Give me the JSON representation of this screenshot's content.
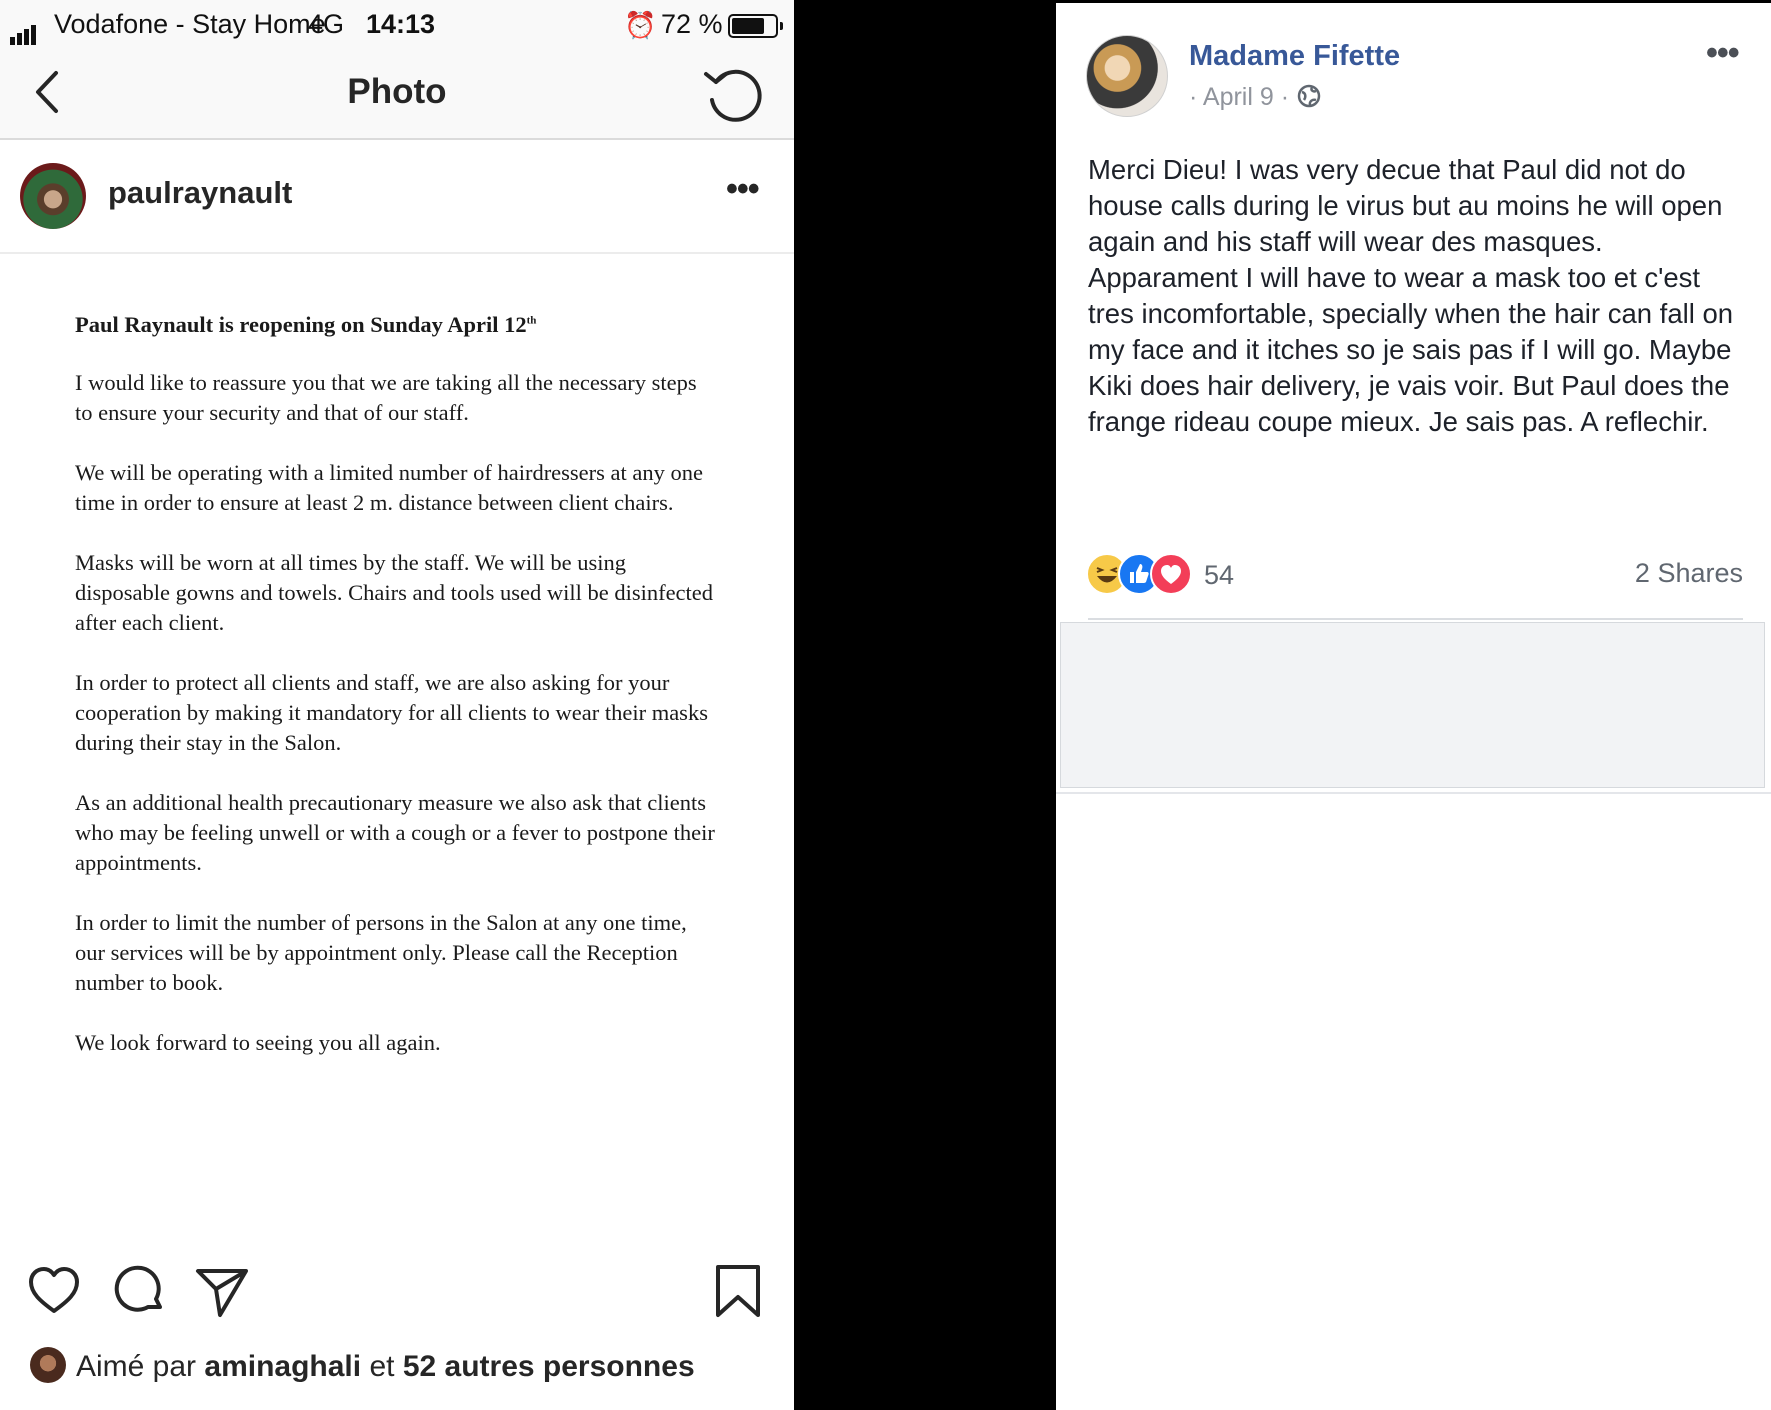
{
  "instagram": {
    "status_bar": {
      "carrier": "Vodafone - Stay Home",
      "network": "4G",
      "time": "14:13",
      "battery": "72 %",
      "battery_level": 0.72
    },
    "nav": {
      "title": "Photo"
    },
    "post": {
      "username": "paulraynault",
      "notice": {
        "title": "Paul Raynault is reopening on Sunday April 12",
        "title_suffix": "th",
        "paragraphs": [
          "I would like to reassure you that we are taking all the necessary steps to ensure your security and that of our staff.",
          "We will be operating with a limited number of hairdressers at any one time in order to ensure at least 2 m. distance between client chairs.",
          "Masks will be worn at all times by the staff.  We will be using disposable gowns and towels.  Chairs and tools used will be disinfected after each client.",
          "In order to protect all clients and staff, we are also asking for your cooperation by making it mandatory for all clients to wear their masks during their stay in the Salon.",
          "As an additional health precautionary measure we also ask that clients who may be feeling unwell or with a cough or a fever to postpone their appointments.",
          "In order to limit the number of persons in the Salon at any one time, our services will be by appointment only.  Please call the Reception number to book.",
          "We look forward to seeing you all again."
        ]
      },
      "likes": {
        "prefix": "Aimé par",
        "user": "aminaghali",
        "connector": "et",
        "others": "52 autres personnes"
      }
    }
  },
  "facebook": {
    "author": "Madame Fifette",
    "date": "· April 9 ·",
    "text": "Merci Dieu! I was very decue that Paul did not do house calls during le virus but au moins he will open again and his staff will wear des masques. Apparament I will have to wear a mask too et c'est tres incomfortable, specially when the hair can fall on my face and it itches so je sais pas if I will go. Maybe Kiki does hair delivery, je vais voir. But Paul does the frange rideau coupe mieux. Je sais pas. A reflechir.",
    "reaction_count": "54",
    "shares": "2 Shares",
    "reactions": [
      "haha",
      "like",
      "love"
    ]
  },
  "colors": {
    "fb_link": "#385898",
    "meta_gray": "#90949c",
    "like_blue": "#1877f2",
    "love_red": "#f33e58",
    "haha_yellow": "#f7c948"
  },
  "icons": [
    "signal-icon",
    "alarm-icon",
    "battery-icon",
    "back-chevron-icon",
    "rotate-icon",
    "more-icon",
    "heart-icon",
    "comment-icon",
    "share-icon",
    "bookmark-icon",
    "globe-icon"
  ]
}
